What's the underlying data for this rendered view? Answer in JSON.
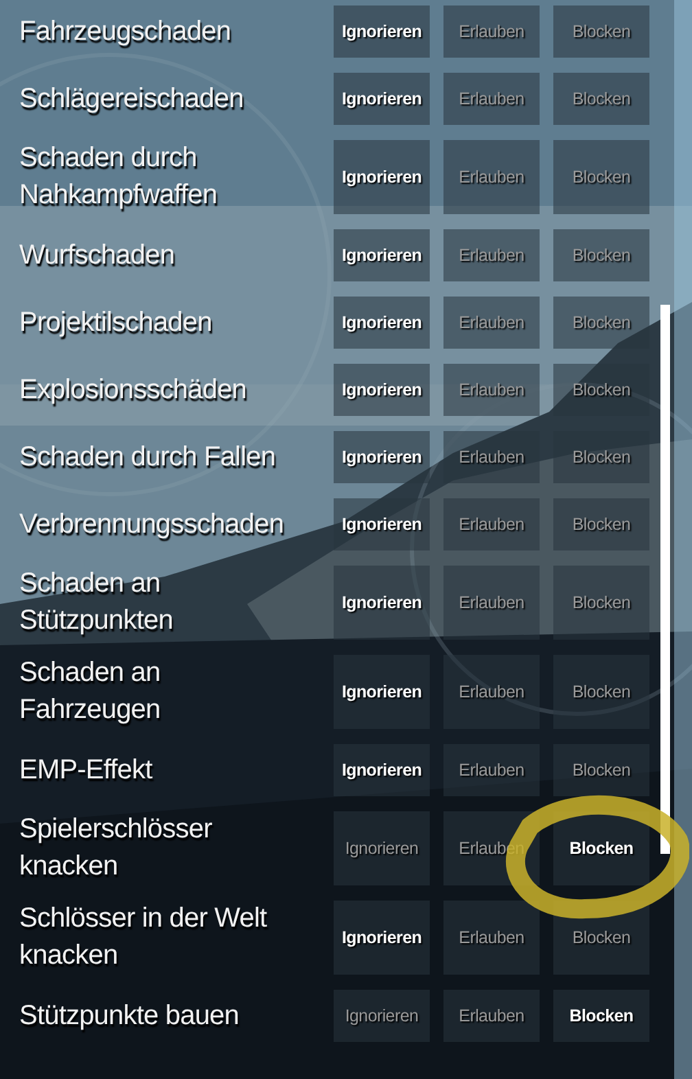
{
  "rules": [
    {
      "label": "Fahrzeugschaden",
      "options": [
        {
          "label": "Ignorieren",
          "selected": true
        },
        {
          "label": "Erlauben",
          "selected": false
        },
        {
          "label": "Blocken",
          "selected": false
        }
      ]
    },
    {
      "label": "Schlägereischaden",
      "options": [
        {
          "label": "Ignorieren",
          "selected": true
        },
        {
          "label": "Erlauben",
          "selected": false
        },
        {
          "label": "Blocken",
          "selected": false
        }
      ]
    },
    {
      "label": "Schaden durch Nahkampfwaffen",
      "options": [
        {
          "label": "Ignorieren",
          "selected": true
        },
        {
          "label": "Erlauben",
          "selected": false
        },
        {
          "label": "Blocken",
          "selected": false
        }
      ]
    },
    {
      "label": "Wurfschaden",
      "options": [
        {
          "label": "Ignorieren",
          "selected": true
        },
        {
          "label": "Erlauben",
          "selected": false
        },
        {
          "label": "Blocken",
          "selected": false
        }
      ]
    },
    {
      "label": "Projektilschaden",
      "options": [
        {
          "label": "Ignorieren",
          "selected": true
        },
        {
          "label": "Erlauben",
          "selected": false
        },
        {
          "label": "Blocken",
          "selected": false
        }
      ]
    },
    {
      "label": "Explosionsschäden",
      "options": [
        {
          "label": "Ignorieren",
          "selected": true
        },
        {
          "label": "Erlauben",
          "selected": false
        },
        {
          "label": "Blocken",
          "selected": false
        }
      ]
    },
    {
      "label": "Schaden durch Fallen",
      "options": [
        {
          "label": "Ignorieren",
          "selected": true
        },
        {
          "label": "Erlauben",
          "selected": false
        },
        {
          "label": "Blocken",
          "selected": false
        }
      ]
    },
    {
      "label": "Verbrennungsschaden",
      "options": [
        {
          "label": "Ignorieren",
          "selected": true
        },
        {
          "label": "Erlauben",
          "selected": false
        },
        {
          "label": "Blocken",
          "selected": false
        }
      ]
    },
    {
      "label": "Schaden an Stützpunkten",
      "options": [
        {
          "label": "Ignorieren",
          "selected": true
        },
        {
          "label": "Erlauben",
          "selected": false
        },
        {
          "label": "Blocken",
          "selected": false
        }
      ]
    },
    {
      "label": "Schaden an Fahrzeugen",
      "options": [
        {
          "label": "Ignorieren",
          "selected": true
        },
        {
          "label": "Erlauben",
          "selected": false
        },
        {
          "label": "Blocken",
          "selected": false
        }
      ]
    },
    {
      "label": "EMP-Effekt",
      "options": [
        {
          "label": "Ignorieren",
          "selected": true
        },
        {
          "label": "Erlauben",
          "selected": false
        },
        {
          "label": "Blocken",
          "selected": false
        }
      ]
    },
    {
      "label": "Spielerschlösser knacken",
      "options": [
        {
          "label": "Ignorieren",
          "selected": false
        },
        {
          "label": "Erlauben",
          "selected": false
        },
        {
          "label": "Blocken",
          "selected": true
        }
      ]
    },
    {
      "label": "Schlösser in der Welt knacken",
      "options": [
        {
          "label": "Ignorieren",
          "selected": true
        },
        {
          "label": "Erlauben",
          "selected": false
        },
        {
          "label": "Blocken",
          "selected": false
        }
      ]
    },
    {
      "label": "Stützpunkte bauen",
      "options": [
        {
          "label": "Ignorieren",
          "selected": false
        },
        {
          "label": "Erlauben",
          "selected": false
        },
        {
          "label": "Blocken",
          "selected": true
        }
      ]
    }
  ]
}
